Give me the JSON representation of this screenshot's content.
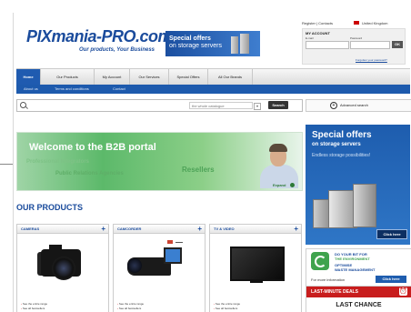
{
  "header": {
    "logo_text": "PIXmania-PRO.com",
    "logo_tag": "Our products, Your Business",
    "banner_title": "Special offers",
    "banner_sub": "on storage servers",
    "top_links": "Register | Contacts",
    "language": "United Kingdom"
  },
  "account": {
    "heading": "MY ACCOUNT",
    "email_label": "E-mail",
    "password_label": "Password",
    "ok_label": "OK",
    "forgot": "Forgotten your password?"
  },
  "nav": {
    "items": [
      {
        "label": "Home"
      },
      {
        "label": "Our Products"
      },
      {
        "label": "My Account"
      },
      {
        "label": "Our Services"
      },
      {
        "label": "Special Offers"
      },
      {
        "label": "All Our Brands"
      }
    ],
    "sub": [
      {
        "label": "About us"
      },
      {
        "label": "Terms and conditions"
      },
      {
        "label": "Contact"
      }
    ]
  },
  "search": {
    "scope": "the whole catalogue",
    "go_label": "Search",
    "advanced": "Advanced search"
  },
  "hero": {
    "title": "Welcome to the B2B portal",
    "w1": "Professional Integrators",
    "w2": "Public Relations Agencies",
    "w3": "Resellers",
    "expand": "Expand"
  },
  "products": {
    "heading": "OUR PRODUCTS",
    "items": [
      {
        "name": "CAMERAS",
        "l1": "See the entire range",
        "l2": "See all bestsellers"
      },
      {
        "name": "CAMCORDER",
        "l1": "See the entire range",
        "l2": "See all bestsellers"
      },
      {
        "name": "TV & VIDEO",
        "l1": "See the entire range",
        "l2": "See all bestsellers"
      }
    ]
  },
  "right": {
    "offer_title": "Special offers",
    "offer_sub": "on storage servers",
    "offer_tag": "Endless storage possibilities!",
    "click_here": "Click here",
    "env_t1": "DO YOUR BIT FOR",
    "env_t1b": "THE ENVIRONMENT",
    "env_t2": "OPTIMISE",
    "env_t2b": "WASTE MANAGEMENT",
    "env_info": "For more information",
    "env_btn": "Click here",
    "deals_title": "LAST-MINUTE DEALS",
    "last_chance": "LAST CHANCE"
  },
  "colors": {
    "brand": "#1a4b9c",
    "nav_active": "#1f5bb0",
    "deal_red": "#c81d1d",
    "hero_green": "#5cb96a"
  }
}
